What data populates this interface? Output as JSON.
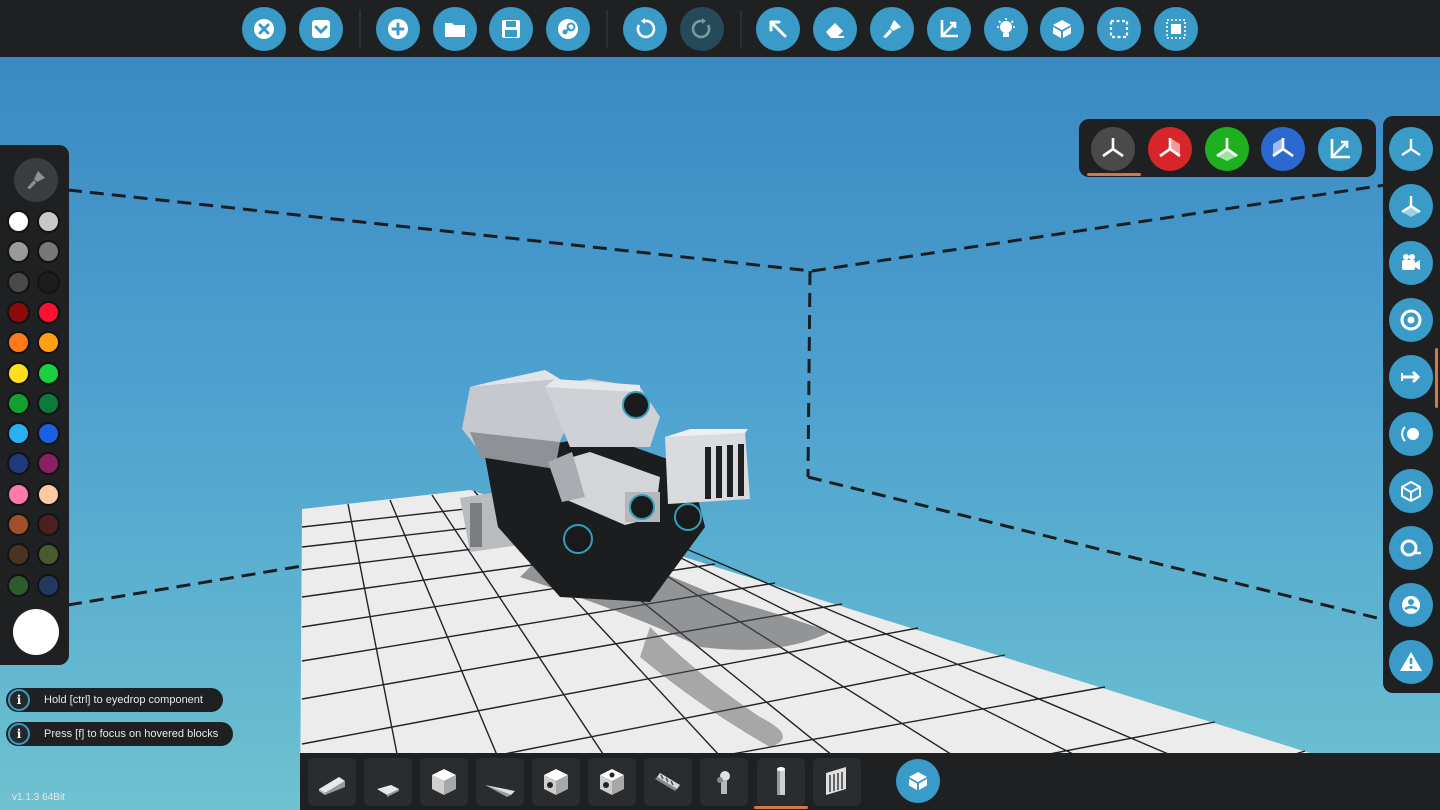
{
  "colors": {
    "accent": "#3a9bc9",
    "panel": "#1e2022",
    "highlight": "#d07a48"
  },
  "toolbar": {
    "buttons": [
      {
        "id": "close",
        "icon": "close-icon"
      },
      {
        "id": "menu",
        "icon": "menu-down-icon"
      },
      {
        "id": "new",
        "icon": "plus-icon"
      },
      {
        "id": "open",
        "icon": "folder-icon"
      },
      {
        "id": "save",
        "icon": "save-icon"
      },
      {
        "id": "steam",
        "icon": "steam-icon"
      },
      {
        "id": "undo",
        "icon": "undo-icon"
      },
      {
        "id": "redo",
        "icon": "redo-icon",
        "disabled": true
      },
      {
        "id": "select",
        "icon": "cursor-icon"
      },
      {
        "id": "erase",
        "icon": "eraser-icon"
      },
      {
        "id": "paint",
        "icon": "paint-brush-icon"
      },
      {
        "id": "transform",
        "icon": "axes-icon"
      },
      {
        "id": "light",
        "icon": "lightbulb-icon"
      },
      {
        "id": "blocks",
        "icon": "blocks-icon"
      },
      {
        "id": "marquee",
        "icon": "selection-box-icon"
      },
      {
        "id": "chip",
        "icon": "chip-icon"
      }
    ]
  },
  "palette": {
    "swatches": [
      "#ffffff",
      "#c8c8c8",
      "#9a9a9a",
      "#787878",
      "#4a4a4a",
      "#1c1c1c",
      "#8c0a0a",
      "#ff1030",
      "#ff7a1a",
      "#ffa010",
      "#ffe020",
      "#18d040",
      "#13a030",
      "#0e7a3a",
      "#2ab0f0",
      "#1a60e0",
      "#233a7a",
      "#8a2060",
      "#ff7aa8",
      "#ffc8a0",
      "#a0502a",
      "#4a2020",
      "#4a3420",
      "#4a5a30",
      "#2e5a30",
      "#22385e"
    ],
    "current_color": "#ffffff"
  },
  "gizmo": {
    "buttons": [
      {
        "id": "all",
        "icon": "axis-all-icon",
        "color": "#4a4a4a"
      },
      {
        "id": "x",
        "icon": "axis-x-icon",
        "color": "#d8252a"
      },
      {
        "id": "y",
        "icon": "axis-y-icon",
        "color": "#1fb01f"
      },
      {
        "id": "z",
        "icon": "axis-z-icon",
        "color": "#2a6ad0"
      },
      {
        "id": "free",
        "icon": "axes-icon",
        "color": "#3a9bc9"
      }
    ]
  },
  "rightbar": {
    "buttons": [
      {
        "id": "view-axes",
        "icon": "axes-tripod-icon"
      },
      {
        "id": "view-plane",
        "icon": "plane-tripod-icon"
      },
      {
        "id": "camera",
        "icon": "camera-icon"
      },
      {
        "id": "target",
        "icon": "target-icon"
      },
      {
        "id": "direction",
        "icon": "arrow-right-icon"
      },
      {
        "id": "orbit",
        "icon": "orbit-icon"
      },
      {
        "id": "cube",
        "icon": "cube-outline-icon"
      },
      {
        "id": "measure",
        "icon": "tape-measure-icon"
      },
      {
        "id": "pivot",
        "icon": "pivot-icon"
      },
      {
        "id": "warning",
        "icon": "warning-icon"
      }
    ]
  },
  "hints": [
    {
      "text": "Hold [ctrl] to eyedrop component"
    },
    {
      "text": "Press [f] to focus on hovered blocks"
    }
  ],
  "parts_bar": {
    "items": [
      {
        "icon": "wedge-block-icon"
      },
      {
        "icon": "flat-wedge-icon"
      },
      {
        "icon": "cube-block-icon"
      },
      {
        "icon": "long-wedge-icon"
      },
      {
        "icon": "cube-hole-icon"
      },
      {
        "icon": "cube-hole-dark-icon"
      },
      {
        "icon": "pipe-icon"
      },
      {
        "icon": "joint-icon"
      },
      {
        "icon": "cylinder-icon",
        "selected": true
      },
      {
        "icon": "radiator-icon"
      }
    ],
    "build_button_icon": "blocks-icon"
  },
  "version": "v1.1.3 64Bit"
}
